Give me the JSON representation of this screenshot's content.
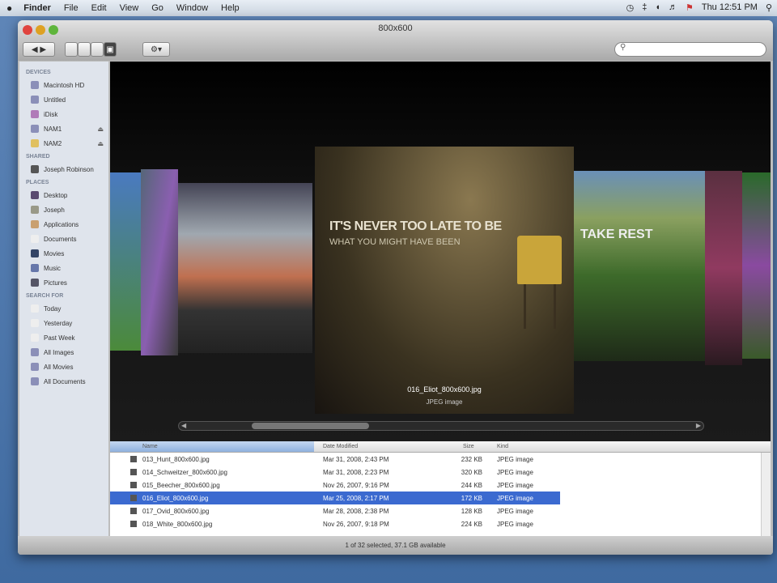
{
  "menubar": {
    "apple": "",
    "app": "Finder",
    "items": [
      "File",
      "Edit",
      "View",
      "Go",
      "Window",
      "Help"
    ],
    "clock": "Thu 12:51 PM"
  },
  "window": {
    "title": "800x600",
    "search_placeholder": ""
  },
  "sidebar": {
    "devices_header": "DEVICES",
    "devices": [
      "Macintosh HD",
      "Untitled",
      "iDisk",
      "NAM1",
      "NAM2"
    ],
    "shared_header": "SHARED",
    "shared": [
      "Joseph Robinson"
    ],
    "places_header": "PLACES",
    "places": [
      "Desktop",
      "Joseph",
      "Applications",
      "Documents",
      "Movies",
      "Music",
      "Pictures"
    ],
    "search_header": "SEARCH FOR",
    "search": [
      "Today",
      "Yesterday",
      "Past Week",
      "All Images",
      "All Movies",
      "All Documents"
    ]
  },
  "coverflow": {
    "cover_line1": "IT'S NEVER TOO LATE TO BE",
    "cover_line2": "WHAT YOU MIGHT HAVE BEEN",
    "side_cover_text": "TAKE REST",
    "selected_name": "016_Eliot_800x600.jpg",
    "selected_kind": "JPEG image"
  },
  "list": {
    "columns": [
      "Name",
      "Date Modified",
      "Size",
      "Kind"
    ],
    "rows": [
      {
        "name": "013_Hunt_800x600.jpg",
        "date": "Mar 31, 2008, 2:43 PM",
        "size": "232 KB",
        "kind": "JPEG image"
      },
      {
        "name": "014_Schweitzer_800x600.jpg",
        "date": "Mar 31, 2008, 2:23 PM",
        "size": "320 KB",
        "kind": "JPEG image"
      },
      {
        "name": "015_Beecher_800x600.jpg",
        "date": "Nov 26, 2007, 9:16 PM",
        "size": "244 KB",
        "kind": "JPEG image"
      },
      {
        "name": "016_Eliot_800x600.jpg",
        "date": "Mar 25, 2008, 2:17 PM",
        "size": "172 KB",
        "kind": "JPEG image"
      },
      {
        "name": "017_Ovid_800x600.jpg",
        "date": "Mar 28, 2008, 2:38 PM",
        "size": "128 KB",
        "kind": "JPEG image"
      },
      {
        "name": "018_White_800x600.jpg",
        "date": "Nov 26, 2007, 9:18 PM",
        "size": "224 KB",
        "kind": "JPEG image"
      }
    ]
  },
  "status": "1 of 32 selected, 37.1 GB available"
}
